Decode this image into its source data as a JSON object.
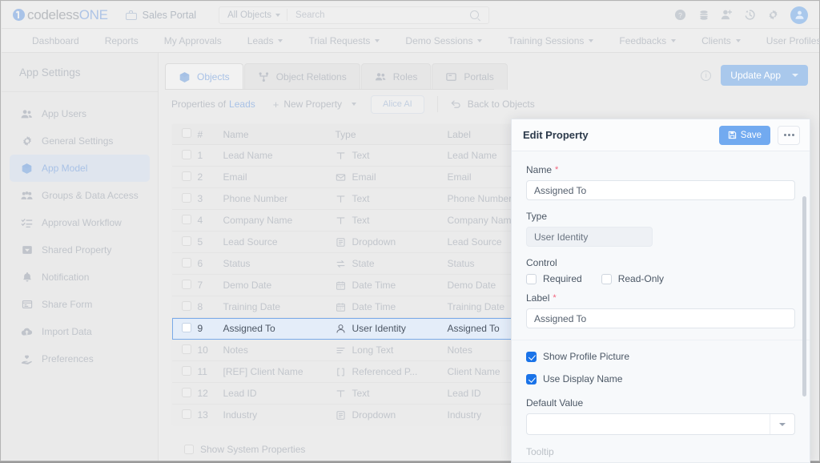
{
  "topbar": {
    "logo_primary": "codeless",
    "logo_secondary": "ONE",
    "portal_name": "Sales Portal",
    "object_selector": "All Objects",
    "search_placeholder": "Search",
    "icons": [
      "help-icon",
      "database-icon",
      "add-user-icon",
      "history-icon",
      "gear-icon",
      "avatar"
    ]
  },
  "nav": {
    "items": [
      {
        "label": "Dashboard",
        "caret": false
      },
      {
        "label": "Reports",
        "caret": false
      },
      {
        "label": "My Approvals",
        "caret": false
      },
      {
        "label": "Leads",
        "caret": true
      },
      {
        "label": "Trial Requests",
        "caret": true
      },
      {
        "label": "Demo Sessions",
        "caret": true
      },
      {
        "label": "Training Sessions",
        "caret": true
      },
      {
        "label": "Feedbacks",
        "caret": true
      },
      {
        "label": "Clients",
        "caret": true
      },
      {
        "label": "User Profiles",
        "caret": true
      }
    ]
  },
  "sidebar": {
    "title": "App Settings",
    "items": [
      {
        "label": "App Users",
        "icon": "users-icon",
        "active": false
      },
      {
        "label": "General Settings",
        "icon": "gear-icon",
        "active": false
      },
      {
        "label": "App Model",
        "icon": "cube-icon",
        "active": true
      },
      {
        "label": "Groups & Data Access",
        "icon": "group-icon",
        "active": false
      },
      {
        "label": "Approval Workflow",
        "icon": "checklist-icon",
        "active": false
      },
      {
        "label": "Shared Property",
        "icon": "inbox-icon",
        "active": false
      },
      {
        "label": "Notification",
        "icon": "bell-icon",
        "active": false
      },
      {
        "label": "Share Form",
        "icon": "form-icon",
        "active": false
      },
      {
        "label": "Import Data",
        "icon": "cloud-upload-icon",
        "active": false
      },
      {
        "label": "Preferences",
        "icon": "hand-heart-icon",
        "active": false
      }
    ]
  },
  "tabs": [
    {
      "label": "Objects",
      "icon": "cube-icon",
      "active": true
    },
    {
      "label": "Object Relations",
      "icon": "relations-icon",
      "active": false
    },
    {
      "label": "Roles",
      "icon": "roles-icon",
      "active": false
    },
    {
      "label": "Portals",
      "icon": "portal-icon",
      "active": false
    }
  ],
  "header_actions": {
    "info_icon": "info-icon",
    "update_app_label": "Update App"
  },
  "propbar": {
    "properties_of": "Properties of",
    "object_name": "Leads",
    "new_property": "New Property",
    "alice_ai": "Alice AI",
    "back_to_objects": "Back to Objects"
  },
  "table": {
    "columns": [
      "#",
      "Name",
      "Type",
      "Label"
    ],
    "rows": [
      {
        "num": "1",
        "name": "Lead Name",
        "type": "Text",
        "type_icon": "text-icon",
        "label": "Lead Name",
        "selected": false,
        "dot": false
      },
      {
        "num": "2",
        "name": "Email",
        "type": "Email",
        "type_icon": "email-icon",
        "label": "Email",
        "selected": false,
        "dot": false
      },
      {
        "num": "3",
        "name": "Phone Number",
        "type": "Text",
        "type_icon": "text-icon",
        "label": "Phone Number",
        "selected": false,
        "dot": false
      },
      {
        "num": "4",
        "name": "Company Name",
        "type": "Text",
        "type_icon": "text-icon",
        "label": "Company Name",
        "selected": false,
        "dot": false
      },
      {
        "num": "5",
        "name": "Lead Source",
        "type": "Dropdown",
        "type_icon": "dropdown-icon",
        "label": "Lead Source",
        "selected": false,
        "dot": false
      },
      {
        "num": "6",
        "name": "Status",
        "type": "State",
        "type_icon": "state-icon",
        "label": "Status",
        "selected": false,
        "dot": true
      },
      {
        "num": "7",
        "name": "Demo Date",
        "type": "Date Time",
        "type_icon": "calendar-icon",
        "label": "Demo Date",
        "selected": false,
        "dot": false
      },
      {
        "num": "8",
        "name": "Training Date",
        "type": "Date Time",
        "type_icon": "calendar-icon",
        "label": "Training Date",
        "selected": false,
        "dot": false
      },
      {
        "num": "9",
        "name": "Assigned To",
        "type": "User Identity",
        "type_icon": "user-icon",
        "label": "Assigned To",
        "selected": true,
        "dot": false
      },
      {
        "num": "10",
        "name": "Notes",
        "type": "Long Text",
        "type_icon": "longtext-icon",
        "label": "Notes",
        "selected": false,
        "dot": false
      },
      {
        "num": "11",
        "name": "[REF] Client Name",
        "type": "Referenced P...",
        "type_icon": "reference-icon",
        "label": "Client Name",
        "selected": false,
        "dot": false
      },
      {
        "num": "12",
        "name": "Lead ID",
        "type": "Text",
        "type_icon": "text-icon",
        "label": "Lead ID",
        "selected": false,
        "dot": false
      },
      {
        "num": "13",
        "name": "Industry",
        "type": "Dropdown",
        "type_icon": "dropdown-icon",
        "label": "Industry",
        "selected": false,
        "dot": false
      }
    ],
    "show_system_properties": "Show System Properties"
  },
  "panel": {
    "title": "Edit Property",
    "save_label": "Save",
    "more_label": "more-options",
    "name_label": "Name",
    "name_value": "Assigned To",
    "type_label": "Type",
    "type_value": "User Identity",
    "control_label": "Control",
    "required_label": "Required",
    "required_checked": false,
    "readonly_label": "Read-Only",
    "readonly_checked": false,
    "field_label_label": "Label",
    "field_label_value": "Assigned To",
    "show_profile_picture_label": "Show Profile Picture",
    "show_profile_picture_checked": true,
    "use_display_name_label": "Use Display Name",
    "use_display_name_checked": true,
    "default_value_label": "Default Value",
    "default_value": "",
    "next_section_label": "Tooltip"
  },
  "colors": {
    "accent_blue": "#1a73e8",
    "save_blue": "#72aaf0",
    "selected_row_bg": "#e4edf9",
    "selected_row_border": "#7aaae8",
    "required_red": "#f2647c",
    "status_dot": "#7aadde"
  }
}
